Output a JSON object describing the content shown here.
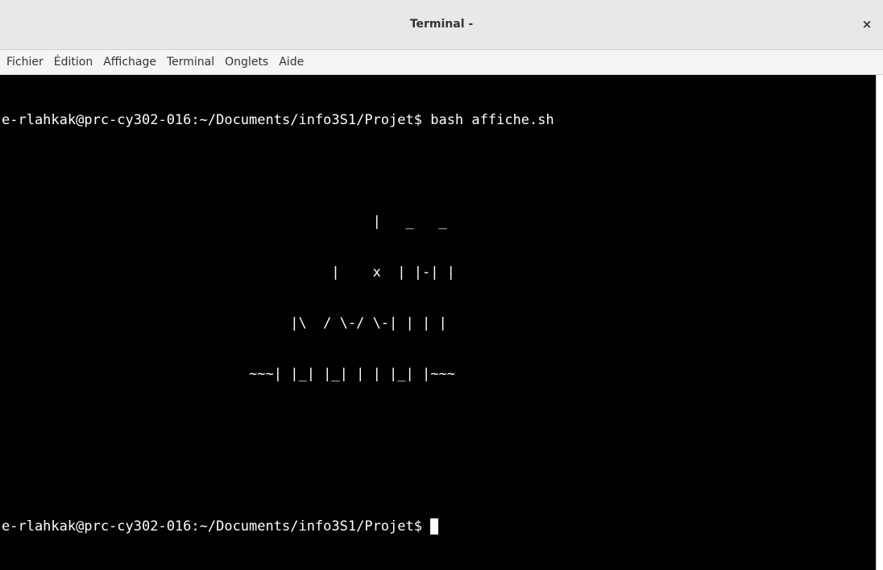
{
  "window": {
    "title": "Terminal -",
    "close_glyph": "×"
  },
  "menu": {
    "items": [
      "Fichier",
      "Édition",
      "Affichage",
      "Terminal",
      "Onglets",
      "Aide"
    ]
  },
  "terminal": {
    "prompt": "e-rlahkak@prc-cy302-016:~/Documents/info3S1/Projet$ ",
    "command": "bash affiche.sh",
    "output_lines": [
      "",
      "                                             |   _   _",
      "                                        |    x  | |-| |",
      "                                   |\\  / \\-/ \\-| | | |",
      "                              ~~~| |_| |_| | | |_| |~~~",
      "",
      ""
    ],
    "current_input": ""
  },
  "colors": {
    "terminal_bg": "#000000",
    "terminal_fg": "#ffffff",
    "titlebar_bg": "#e8e8e7",
    "menubar_bg": "#f6f5f4"
  }
}
